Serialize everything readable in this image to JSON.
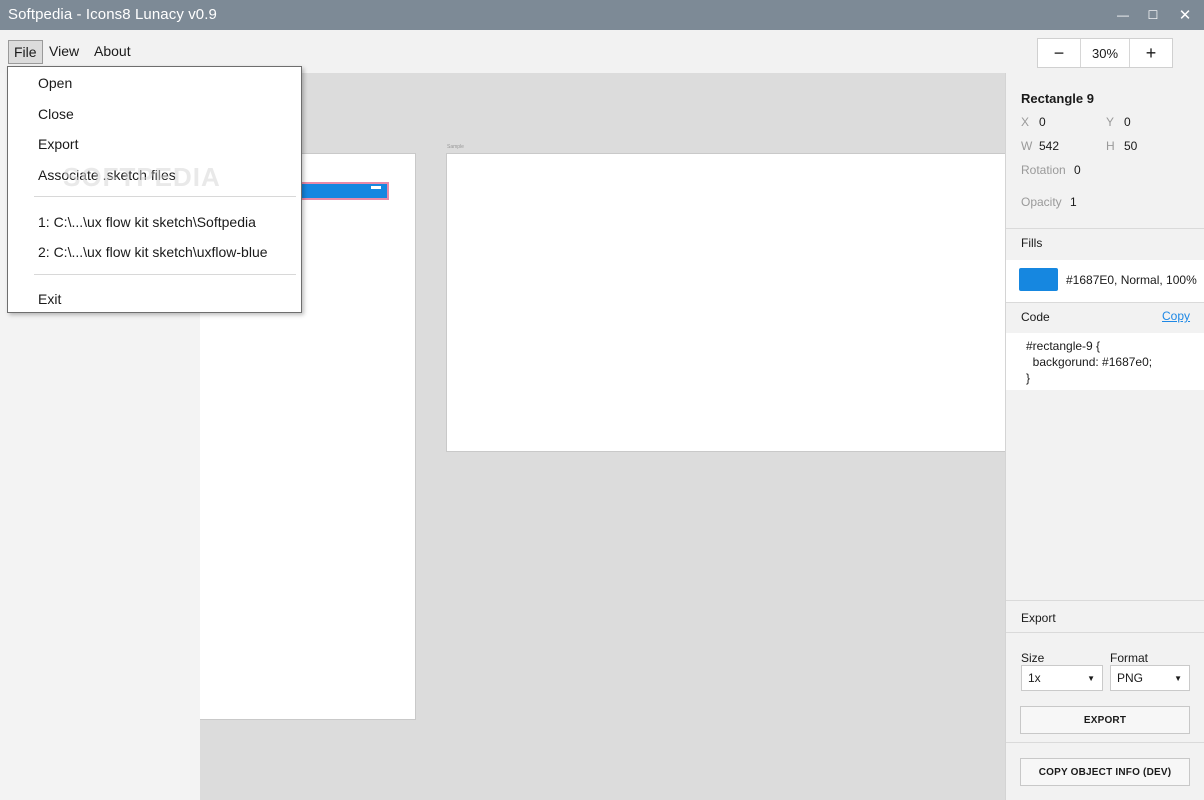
{
  "window": {
    "title": "Softpedia - Icons8 Lunacy v0.9",
    "controls": {
      "minimize": "—",
      "maximize": "☐",
      "close": "✕"
    }
  },
  "menu": {
    "file": "File",
    "view": "View",
    "about": "About"
  },
  "zoom": {
    "minus": "−",
    "value": "30%",
    "plus": "+"
  },
  "file_menu": {
    "items": [
      "Open",
      "Close",
      "Export",
      "Associate .sketch files"
    ],
    "recent": [
      "1:  C:\\...\\ux flow kit sketch\\Softpedia",
      "2:  C:\\...\\ux flow kit sketch\\uxflow-blue"
    ],
    "exit": "Exit"
  },
  "canvas": {
    "artboard2_label": "Sample"
  },
  "watermark": "SOFTPEDIA",
  "inspector": {
    "object_name": "Rectangle 9",
    "x_label": "X",
    "x": "0",
    "y_label": "Y",
    "y": "0",
    "w_label": "W",
    "w": "542",
    "h_label": "H",
    "h": "50",
    "rotation_label": "Rotation",
    "rotation": "0",
    "opacity_label": "Opacity",
    "opacity": "1",
    "fills_title": "Fills",
    "fill_color": "#1687e0",
    "fill_text": "#1687E0, Normal, 100%",
    "code_title": "Code",
    "copy_label": "Copy",
    "code_lines": [
      "#rectangle-9 {",
      "  backgorund: #1687e0;",
      "}"
    ],
    "export_title": "Export",
    "size_label": "Size",
    "size_value": "1x",
    "format_label": "Format",
    "format_value": "PNG",
    "export_button": "EXPORT",
    "copy_info_button": "COPY OBJECT INFO (DEV)"
  }
}
